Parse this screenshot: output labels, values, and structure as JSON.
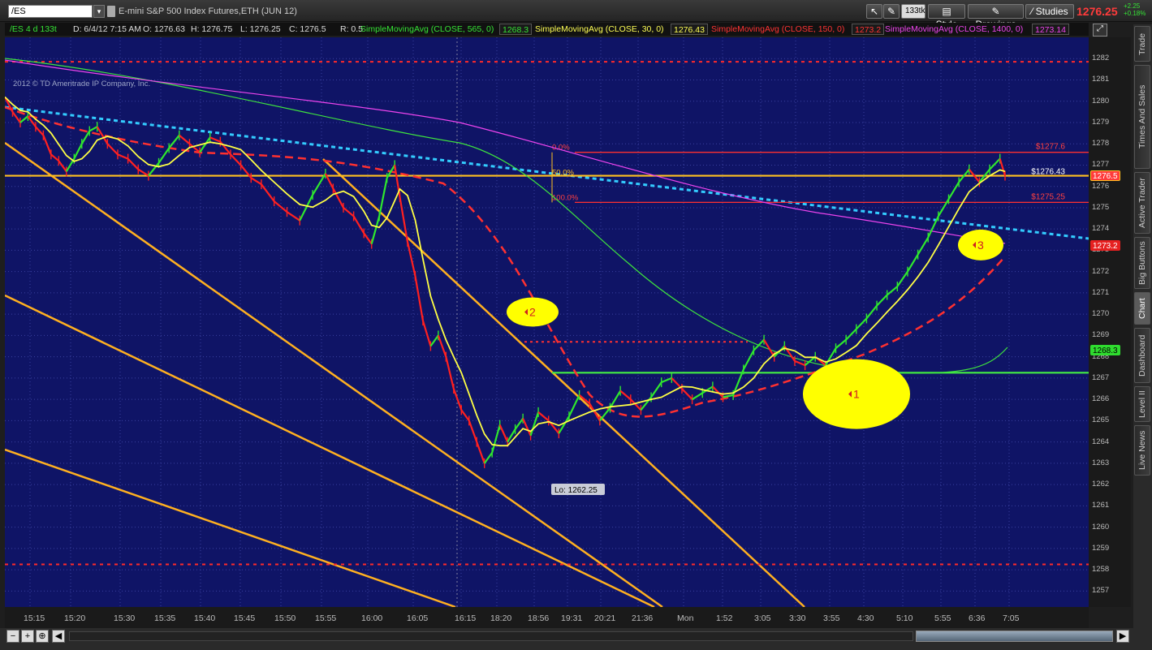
{
  "toolbar": {
    "symbol": "/ES",
    "dropdown_arrow": "▾",
    "contract_title": "E-mini S&P 500 Index Futures,ETH (JUN 12)",
    "aggregation_label": "133tk",
    "style_label": "Style",
    "drawings_label": "Drawings",
    "studies_label": "Studies",
    "last_price": "1276.25",
    "net_change": "+2.25",
    "net_change_pct": "+0.18%",
    "icons": [
      "cursor-icon",
      "wrench-icon",
      "pencil-icon",
      "studies-icon"
    ]
  },
  "infobar": {
    "period": "/ES 4 d 133t",
    "datetime": "D: 6/4/12 7:15 AM",
    "open": "O: 1276.63",
    "high": "H: 1276.75",
    "low": "L: 1276.25",
    "close": "C: 1276.5",
    "range": "R: 0.5",
    "sma1_label": "SimpleMovingAvg (CLOSE, 565, 0)",
    "sma1_value": "1268.3",
    "sma2_label": "SimpleMovingAvg (CLOSE, 30, 0)",
    "sma2_value": "1276.43",
    "sma3_label": "SimpleMovingAvg (CLOSE, 150, 0)",
    "sma3_value": "1273.2",
    "sma4_label": "SimpleMovingAvg (CLOSE, 1400, 0)",
    "sma4_value": "1273.14",
    "colors": {
      "sma1": "#35e335",
      "sma2": "#ffff55",
      "sma3": "#ff3333",
      "sma4": "#ee44ee"
    }
  },
  "copyright": "2012 © TD Ameritrade IP Company, Inc.",
  "side_tabs": [
    "Trade",
    "Times And Sales",
    "Active Trader",
    "Big Buttons",
    "Chart",
    "Dashboard",
    "Level II",
    "Live News"
  ],
  "side_active": "Chart",
  "chart_data": {
    "type": "line",
    "title": "",
    "xlabel": "",
    "ylabel": "",
    "ylim": [
      1256.25,
      1283.0
    ],
    "y_ticks": [
      1257,
      1258,
      1259,
      1260,
      1261,
      1262,
      1263,
      1264,
      1265,
      1266,
      1267,
      1268,
      1269,
      1270,
      1271,
      1272,
      1273,
      1274,
      1275,
      1276,
      1277,
      1278,
      1279,
      1280,
      1281,
      1282
    ],
    "x_tick_labels": [
      "15:15",
      "15:20",
      "15:30",
      "15:35",
      "15:40",
      "15:45",
      "15:50",
      "15:55",
      "16:00",
      "16:05",
      "16:15",
      "18:20",
      "18:56",
      "19:31",
      "20:21",
      "21:36",
      "Mon",
      "1:52",
      "3:05",
      "3:30",
      "3:55",
      "4:30",
      "5:10",
      "5:55",
      "6:36",
      "7:05"
    ],
    "grid": true,
    "price_series": [
      [
        0,
        1280.2
      ],
      [
        3,
        1279.5
      ],
      [
        6,
        1279.0
      ],
      [
        9,
        1279.3
      ],
      [
        12,
        1278.8
      ],
      [
        15,
        1278.4
      ],
      [
        18,
        1277.5
      ],
      [
        21,
        1277.2
      ],
      [
        24,
        1276.7
      ],
      [
        27,
        1277.3
      ],
      [
        30,
        1278.0
      ],
      [
        33,
        1278.6
      ],
      [
        36,
        1278.8
      ],
      [
        40,
        1278.0
      ],
      [
        44,
        1277.5
      ],
      [
        48,
        1277.3
      ],
      [
        52,
        1276.8
      ],
      [
        56,
        1276.5
      ],
      [
        60,
        1277.1
      ],
      [
        64,
        1277.8
      ],
      [
        68,
        1278.4
      ],
      [
        72,
        1278.0
      ],
      [
        76,
        1277.6
      ],
      [
        80,
        1278.3
      ],
      [
        84,
        1278.1
      ],
      [
        88,
        1277.5
      ],
      [
        92,
        1277.0
      ],
      [
        96,
        1276.4
      ],
      [
        100,
        1276.1
      ],
      [
        105,
        1275.3
      ],
      [
        110,
        1274.8
      ],
      [
        115,
        1274.4
      ],
      [
        120,
        1275.6
      ],
      [
        125,
        1276.6
      ],
      [
        128,
        1275.9
      ],
      [
        132,
        1275.0
      ],
      [
        136,
        1274.6
      ],
      [
        140,
        1273.8
      ],
      [
        143,
        1273.3
      ],
      [
        146,
        1274.6
      ],
      [
        149,
        1276.4
      ],
      [
        152,
        1277.0
      ],
      [
        154,
        1275.5
      ],
      [
        157,
        1273.4
      ],
      [
        160,
        1271.8
      ],
      [
        163,
        1269.7
      ],
      [
        166,
        1268.5
      ],
      [
        169,
        1269.0
      ],
      [
        172,
        1268.0
      ],
      [
        175,
        1266.5
      ],
      [
        178,
        1265.5
      ],
      [
        181,
        1265.0
      ],
      [
        184,
        1264.0
      ],
      [
        187,
        1263.0
      ],
      [
        190,
        1263.5
      ],
      [
        193,
        1264.8
      ],
      [
        196,
        1264.0
      ],
      [
        199,
        1264.6
      ],
      [
        202,
        1265.1
      ],
      [
        205,
        1264.3
      ],
      [
        208,
        1265.4
      ],
      [
        212,
        1265.0
      ],
      [
        216,
        1264.4
      ],
      [
        220,
        1265.2
      ],
      [
        224,
        1266.2
      ],
      [
        228,
        1265.8
      ],
      [
        232,
        1265.0
      ],
      [
        236,
        1265.6
      ],
      [
        240,
        1266.4
      ],
      [
        244,
        1266.0
      ],
      [
        248,
        1265.5
      ],
      [
        252,
        1266.1
      ],
      [
        256,
        1266.8
      ],
      [
        260,
        1267.0
      ],
      [
        264,
        1266.5
      ],
      [
        268,
        1266.0
      ],
      [
        272,
        1266.3
      ],
      [
        276,
        1266.6
      ],
      [
        280,
        1266.1
      ],
      [
        284,
        1266.2
      ],
      [
        288,
        1267.4
      ],
      [
        292,
        1268.3
      ],
      [
        296,
        1268.8
      ],
      [
        300,
        1268.0
      ],
      [
        304,
        1268.5
      ],
      [
        308,
        1267.8
      ],
      [
        312,
        1267.6
      ],
      [
        316,
        1268.0
      ],
      [
        320,
        1267.6
      ],
      [
        324,
        1268.4
      ],
      [
        328,
        1268.8
      ],
      [
        332,
        1269.3
      ],
      [
        336,
        1269.8
      ],
      [
        340,
        1270.4
      ],
      [
        344,
        1270.9
      ],
      [
        348,
        1271.3
      ],
      [
        352,
        1272.0
      ],
      [
        356,
        1272.8
      ],
      [
        360,
        1273.6
      ],
      [
        364,
        1274.6
      ],
      [
        368,
        1275.4
      ],
      [
        372,
        1276.2
      ],
      [
        376,
        1276.8
      ],
      [
        380,
        1276.2
      ],
      [
        384,
        1276.8
      ],
      [
        388,
        1277.3
      ],
      [
        390,
        1276.5
      ]
    ],
    "horizontal_levels": [
      {
        "price": 1281.85,
        "style": "dotted",
        "color": "#ff2a2a"
      },
      {
        "price": 1258.25,
        "style": "dotted",
        "color": "#ff2a2a"
      },
      {
        "price": 1276.5,
        "style": "solid",
        "color": "#ffc020"
      },
      {
        "price": 1267.25,
        "style": "solid",
        "color": "#44ee44"
      }
    ],
    "fibonacci": {
      "levels": [
        {
          "label": "0.0%",
          "price": 1277.6,
          "value_label": "$1277.6"
        },
        {
          "label": "50.0%",
          "price": 1276.43,
          "value_label": "$1276.43"
        },
        {
          "label": "100.0%",
          "price": 1275.25,
          "value_label": "$1275.25"
        }
      ]
    },
    "low_annotation": "Lo: 1262.25",
    "markers": [
      {
        "label": "1",
        "price": 1266.25
      },
      {
        "label": "2",
        "price": 1270.1
      },
      {
        "label": "3",
        "price": 1273.25
      }
    ],
    "price_tags": [
      {
        "price": 1276.5,
        "text": "1276.5",
        "bg": "#ff3b3b",
        "color": "#fff",
        "border": "#ffc020"
      },
      {
        "price": 1273.2,
        "text": "1273.2",
        "bg": "#e62020",
        "color": "#fff",
        "border": "#e62020"
      },
      {
        "price": 1268.3,
        "text": "1268.3",
        "bg": "#2fdc2f",
        "color": "#000",
        "border": "#2fdc2f"
      }
    ]
  },
  "bottom": {
    "zoom_out": "−",
    "zoom_in": "+",
    "pan_left": "◀",
    "pan_right": "▶",
    "fit": "⊕"
  }
}
